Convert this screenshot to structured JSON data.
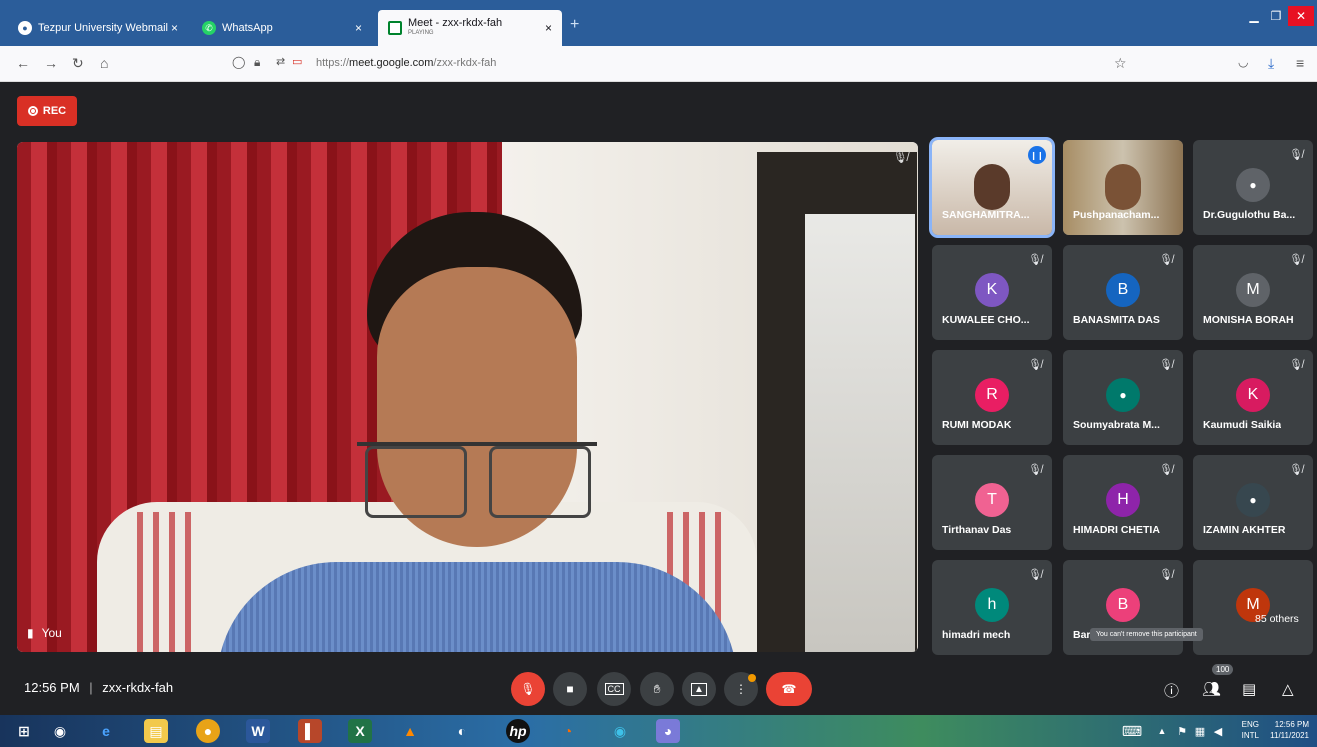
{
  "browser": {
    "tabs": [
      {
        "label": "Tezpur University Webmail",
        "close": "×"
      },
      {
        "label": "WhatsApp",
        "close": "×"
      },
      {
        "label": "Meet - zxx-rkdx-fah",
        "sub": "PLAYING",
        "close": "×"
      }
    ],
    "new_tab": "+",
    "url_prefix": "https://",
    "url_host": "meet.google.com",
    "url_path": "/zxx-rkdx-fah"
  },
  "meet": {
    "rec_label": "REC",
    "self_label": "You",
    "participants": [
      {
        "name": "SANGHAMITRA...",
        "type": "video",
        "speaking": true
      },
      {
        "name": "Pushpanacham...",
        "type": "video"
      },
      {
        "name": "Dr.Gugulothu Ba...",
        "type": "photo",
        "color": "#5f6368"
      },
      {
        "name": "KUWALEE CHO...",
        "initial": "K",
        "color": "#7e57c2"
      },
      {
        "name": "BANASMITA DAS",
        "initial": "B",
        "color": "#1565c0"
      },
      {
        "name": "MONISHA BORAH",
        "initial": "M",
        "color": "#5f6368"
      },
      {
        "name": "RUMI MODAK",
        "initial": "R",
        "color": "#e91e63"
      },
      {
        "name": "Soumyabrata M...",
        "type": "photo",
        "color": "#00796b"
      },
      {
        "name": "Kaumudi Saikia",
        "initial": "K",
        "color": "#d81b60"
      },
      {
        "name": "Tirthanav Das",
        "initial": "T",
        "color": "#f06292"
      },
      {
        "name": "HIMADRI CHETIA",
        "initial": "H",
        "color": "#8e24aa"
      },
      {
        "name": "IZAMIN AKHTER",
        "type": "photo",
        "color": "#37474f"
      },
      {
        "name": "himadri mech",
        "initial": "h",
        "color": "#00897b"
      },
      {
        "name": "Bar",
        "initial": "B",
        "color": "#ec407a"
      },
      {
        "name": "85 others",
        "initial": "M",
        "color": "#bf360c"
      }
    ],
    "tooltip": "You can't remove this participant",
    "time": "12:56 PM",
    "separator": "|",
    "meeting_code": "zxx-rkdx-fah",
    "people_count": "100"
  },
  "taskbar": {
    "lang": "ENG",
    "lang2": "INTL",
    "clock_time": "12:56 PM",
    "clock_date": "11/11/2021"
  }
}
